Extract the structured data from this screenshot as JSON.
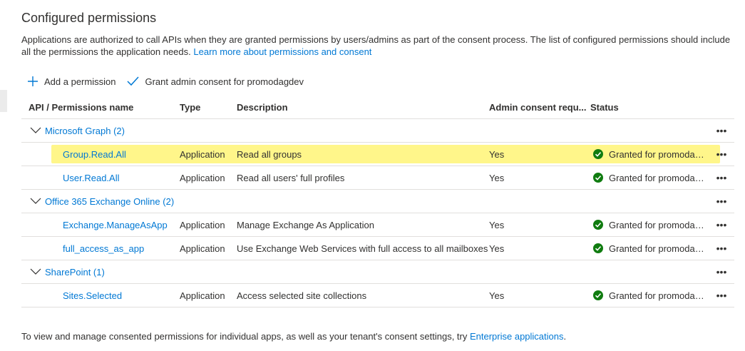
{
  "section": {
    "title": "Configured permissions",
    "intro_text": "Applications are authorized to call APIs when they are granted permissions by users/admins as part of the consent process. The list of configured permissions should include all the permissions the application needs. ",
    "intro_link": "Learn more about permissions and consent"
  },
  "toolbar": {
    "add_label": "Add a permission",
    "grant_label": "Grant admin consent for promodagdev"
  },
  "table": {
    "headers": {
      "name": "API / Permissions name",
      "type": "Type",
      "description": "Description",
      "admin": "Admin consent requ...",
      "status": "Status"
    },
    "groups": [
      {
        "label": "Microsoft Graph (2)",
        "rows": [
          {
            "name": "Group.Read.All",
            "type": "Application",
            "description": "Read all groups",
            "admin": "Yes",
            "status": "Granted for promodagd..."
          },
          {
            "name": "User.Read.All",
            "type": "Application",
            "description": "Read all users' full profiles",
            "admin": "Yes",
            "status": "Granted for promodagd..."
          }
        ]
      },
      {
        "label": "Office 365 Exchange Online (2)",
        "rows": [
          {
            "name": "Exchange.ManageAsApp",
            "type": "Application",
            "description": "Manage Exchange As Application",
            "admin": "Yes",
            "status": "Granted for promodagd..."
          },
          {
            "name": "full_access_as_app",
            "type": "Application",
            "description": "Use Exchange Web Services with full access to all mailboxes",
            "admin": "Yes",
            "status": "Granted for promodagd..."
          }
        ]
      },
      {
        "label": "SharePoint (1)",
        "rows": [
          {
            "name": "Sites.Selected",
            "type": "Application",
            "description": "Access selected site collections",
            "admin": "Yes",
            "status": "Granted for promodagd..."
          }
        ]
      }
    ],
    "more_glyph": "•••"
  },
  "footer": {
    "text": "To view and manage consented permissions for individual apps, as well as your tenant's consent settings, try ",
    "link": "Enterprise applications",
    "end": "."
  },
  "colors": {
    "accent": "#0078d4",
    "success": "#107c10",
    "highlight": "#fff68a"
  }
}
